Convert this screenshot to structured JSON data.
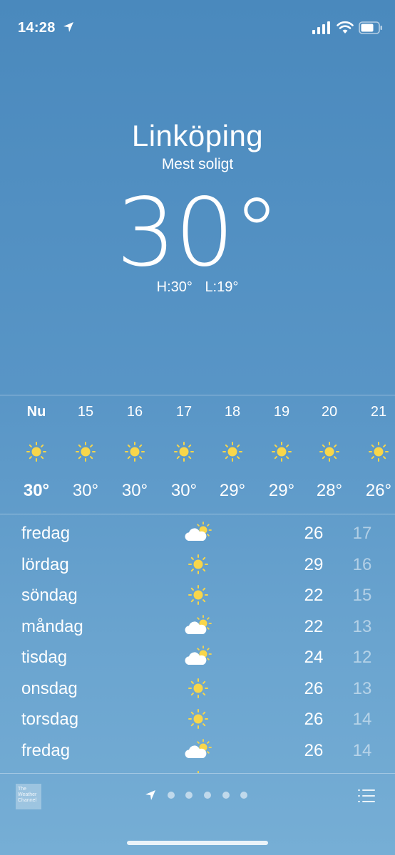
{
  "status_bar": {
    "time": "14:28",
    "icons": [
      "location-arrow-icon",
      "cellular-signal-icon",
      "wifi-icon",
      "battery-icon"
    ]
  },
  "current": {
    "city": "Linköping",
    "condition": "Mest soligt",
    "temperature": "30°",
    "high": "H:30°",
    "low": "L:19°"
  },
  "hourly": [
    {
      "label": "Nu",
      "icon": "sun-icon",
      "temp": "30°"
    },
    {
      "label": "15",
      "icon": "sun-icon",
      "temp": "30°"
    },
    {
      "label": "16",
      "icon": "sun-icon",
      "temp": "30°"
    },
    {
      "label": "17",
      "icon": "sun-icon",
      "temp": "30°"
    },
    {
      "label": "18",
      "icon": "sun-icon",
      "temp": "29°"
    },
    {
      "label": "19",
      "icon": "sun-icon",
      "temp": "29°"
    },
    {
      "label": "20",
      "icon": "sun-icon",
      "temp": "28°"
    },
    {
      "label": "21",
      "icon": "sun-icon",
      "temp": "26°"
    }
  ],
  "daily": [
    {
      "day": "fredag",
      "icon": "partly-cloudy-icon",
      "high": "26",
      "low": "17"
    },
    {
      "day": "lördag",
      "icon": "sun-icon",
      "high": "29",
      "low": "16"
    },
    {
      "day": "söndag",
      "icon": "sun-icon",
      "high": "22",
      "low": "15"
    },
    {
      "day": "måndag",
      "icon": "partly-cloudy-icon",
      "high": "22",
      "low": "13"
    },
    {
      "day": "tisdag",
      "icon": "partly-cloudy-icon",
      "high": "24",
      "low": "12"
    },
    {
      "day": "onsdag",
      "icon": "sun-icon",
      "high": "26",
      "low": "13"
    },
    {
      "day": "torsdag",
      "icon": "sun-icon",
      "high": "26",
      "low": "14"
    },
    {
      "day": "fredag",
      "icon": "partly-cloudy-icon",
      "high": "26",
      "low": "14"
    }
  ],
  "bottom_bar": {
    "logo_text": "The Weather Channel",
    "page_count": 5,
    "icons": [
      "the-weather-channel-logo",
      "location-arrow-icon",
      "list-icon"
    ]
  },
  "colors": {
    "background_top": "#4a89bd",
    "background_bottom": "#76aed5",
    "sun": "#f8d64a",
    "text": "#ffffff"
  }
}
